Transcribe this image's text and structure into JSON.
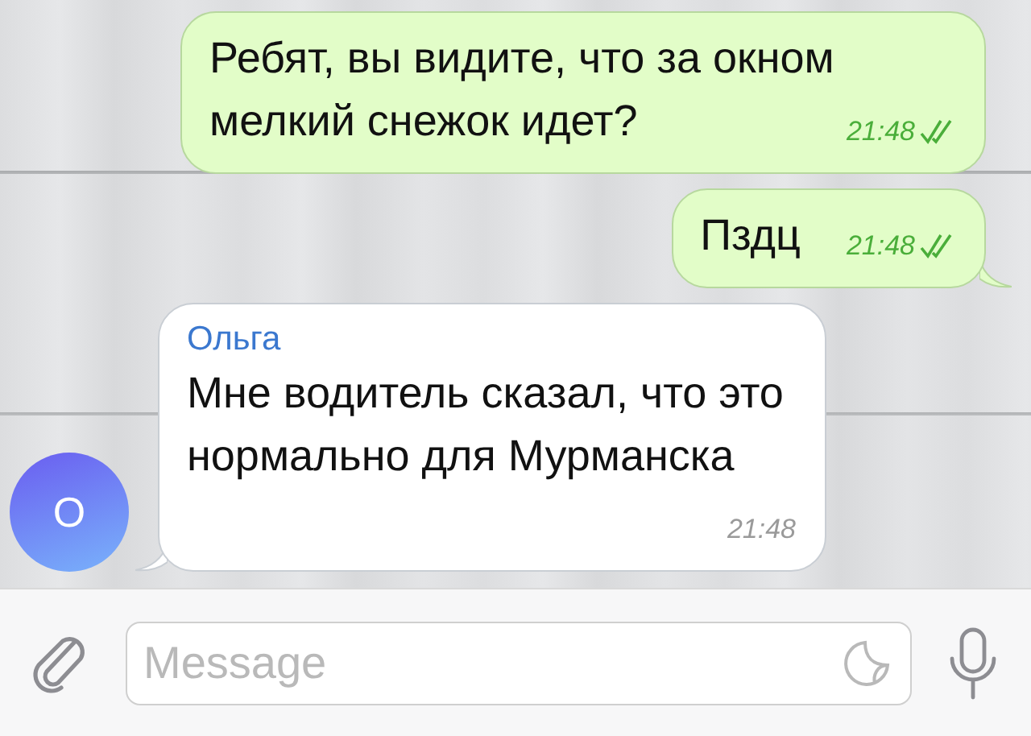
{
  "messages": [
    {
      "outgoing": true,
      "text": "Ребят, вы видите, что за окном мелкий снежок идет?",
      "time": "21:48",
      "read": true,
      "tail": false
    },
    {
      "outgoing": true,
      "text": "Пздц",
      "time": "21:48",
      "read": true,
      "tail": true
    },
    {
      "outgoing": false,
      "sender": "Ольга",
      "avatar": "О",
      "text": "Мне водитель сказал, что это нормально для Мурманска",
      "time": "21:48",
      "tail": true
    }
  ],
  "composer": {
    "placeholder": "Message"
  }
}
